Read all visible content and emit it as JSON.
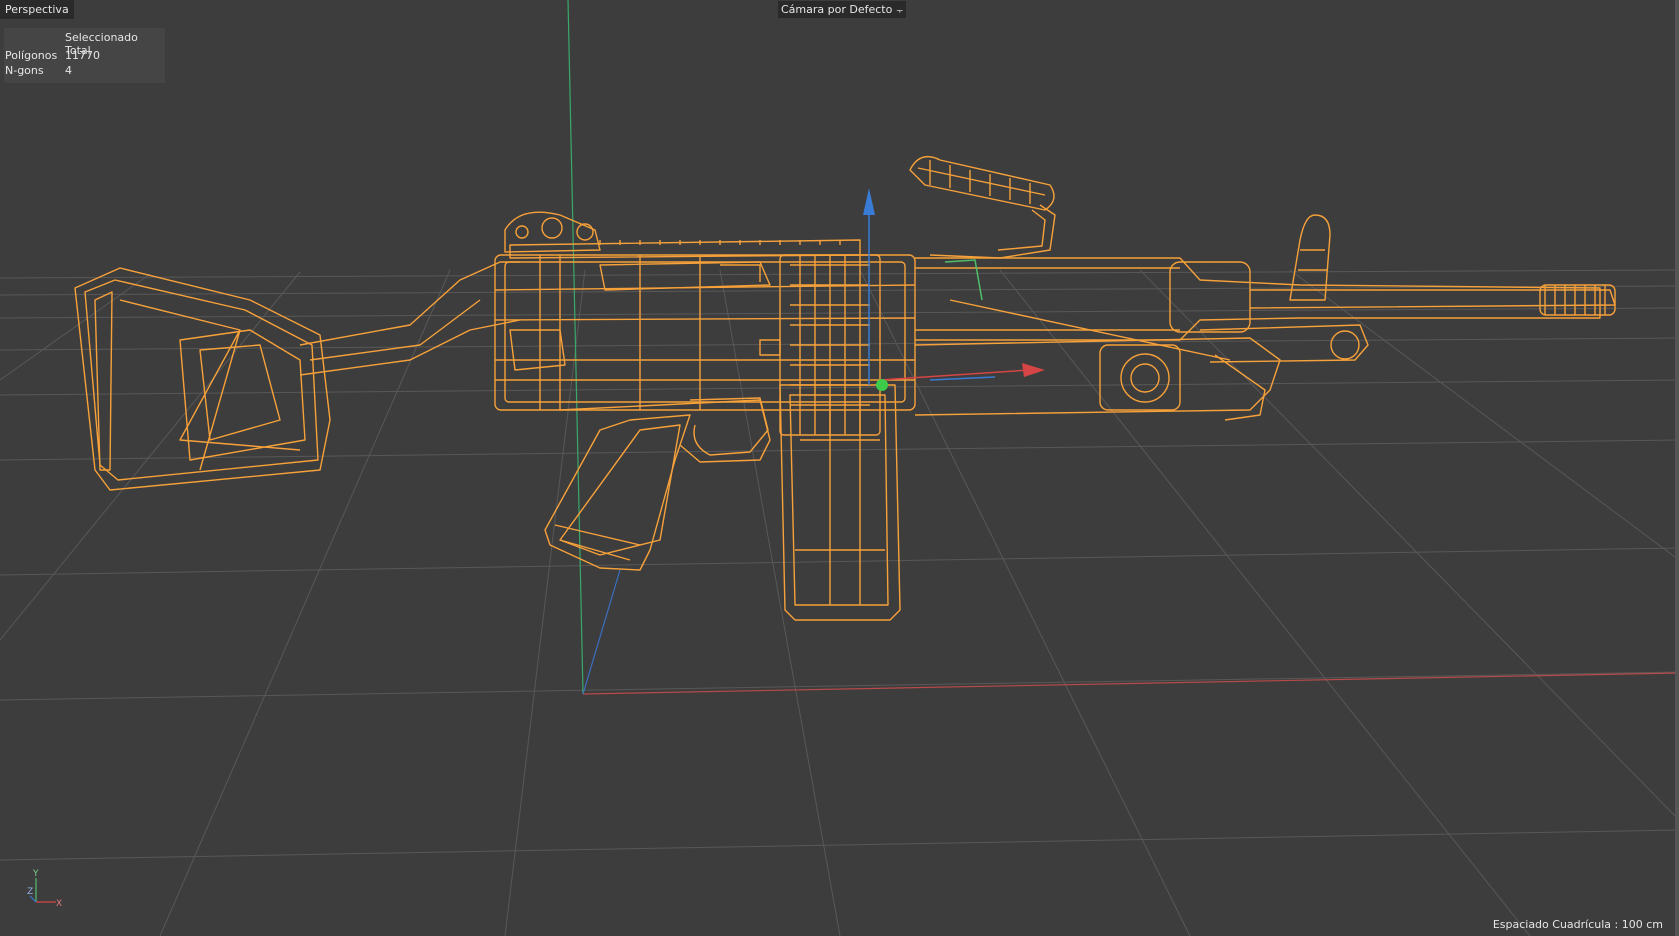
{
  "viewport": {
    "view_name": "Perspectiva",
    "camera": "Cámara por Defecto",
    "camera_icon": "camera-toggle-icon"
  },
  "stats": {
    "header": "Seleccionado Total",
    "rows": [
      {
        "label": "Polígonos",
        "value": "11770"
      },
      {
        "label": "N-gons",
        "value": "4"
      }
    ]
  },
  "axis_gizmo": {
    "y": "Y",
    "z": "Z",
    "x": "X"
  },
  "grid_spacing": "Espaciado Cuadrícula : 100 cm",
  "colors": {
    "wireframe": "#f7a13a",
    "x_axis": "#d64545",
    "y_axis": "#4fbf6a",
    "z_axis": "#3a7bd5",
    "grid": "#595959"
  },
  "model": {
    "name": "machine-gun-wireframe",
    "selected": true
  }
}
